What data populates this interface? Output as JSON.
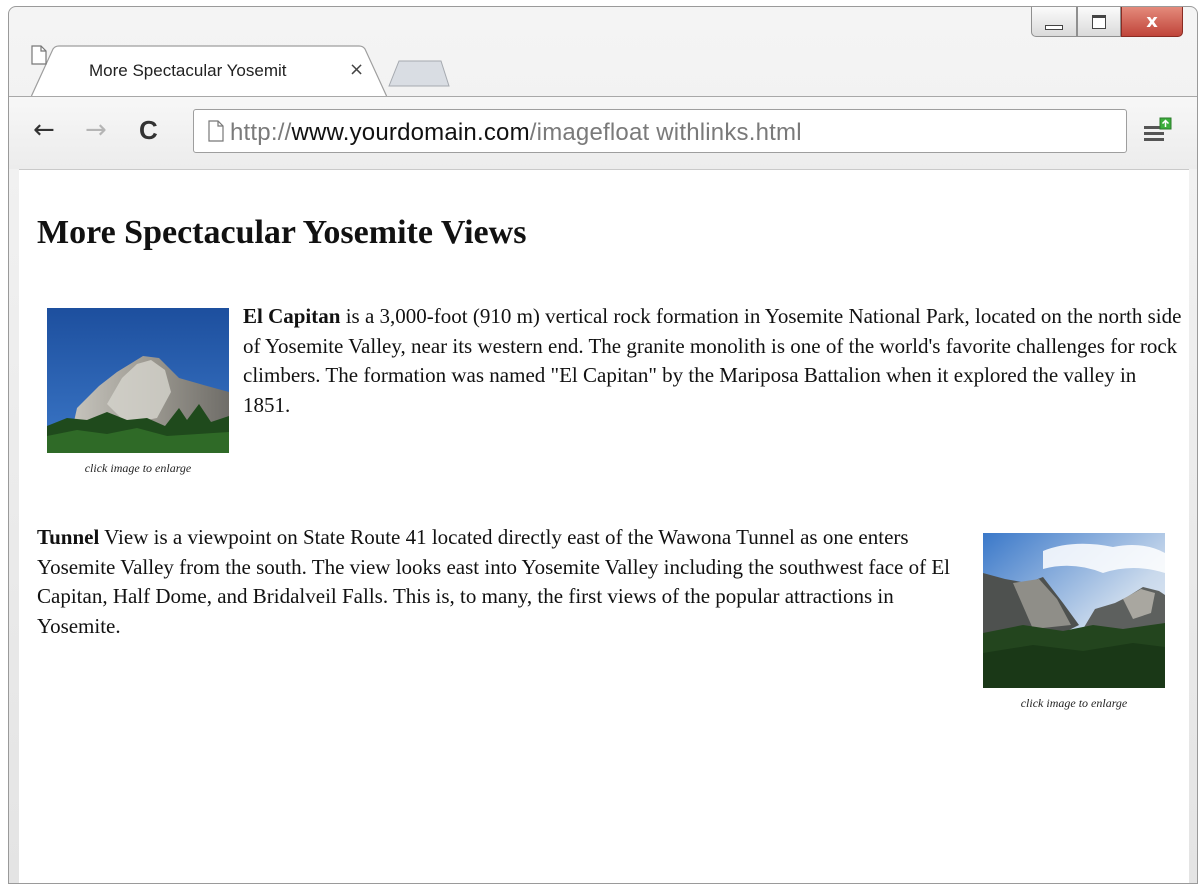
{
  "window": {
    "tab_title": "More Spectacular Yosemit",
    "tab_close": "×",
    "close_glyph": "x"
  },
  "toolbar": {
    "back_glyph": "←",
    "forward_glyph": "→",
    "reload_glyph": "C",
    "url_scheme": "http://",
    "url_host": "www.yourdomain.com",
    "url_path": "/imagefloat withlinks.html"
  },
  "page": {
    "heading": "More Spectacular Yosemite Views",
    "figures": [
      {
        "caption": "click image to enlarge",
        "icon": "el-capitan-photo"
      },
      {
        "caption": "click image to enlarge",
        "icon": "tunnel-view-photo"
      }
    ],
    "paragraphs": [
      {
        "bold": "El Capitan",
        "text": " is a 3,000-foot (910 m) vertical rock formation in Yosemite National Park, located on the north side of Yosemite Valley, near its western end. The granite monolith is one of the world's favorite challenges for rock climbers. The formation was named \"El Capitan\" by the Mariposa Battalion when it explored the valley in 1851."
      },
      {
        "bold": "Tunnel",
        "text": " View is a viewpoint on State Route 41 located directly east of the Wawona Tunnel as one enters Yosemite Valley from the south. The view looks east into Yosemite Valley including the southwest face of El Capitan, Half Dome, and Bridalveil Falls. This is, to many, the first views of the popular attractions in Yosemite."
      }
    ]
  },
  "colors": {
    "close_button": "#c0453a",
    "menu_badge": "#3cae3c"
  }
}
